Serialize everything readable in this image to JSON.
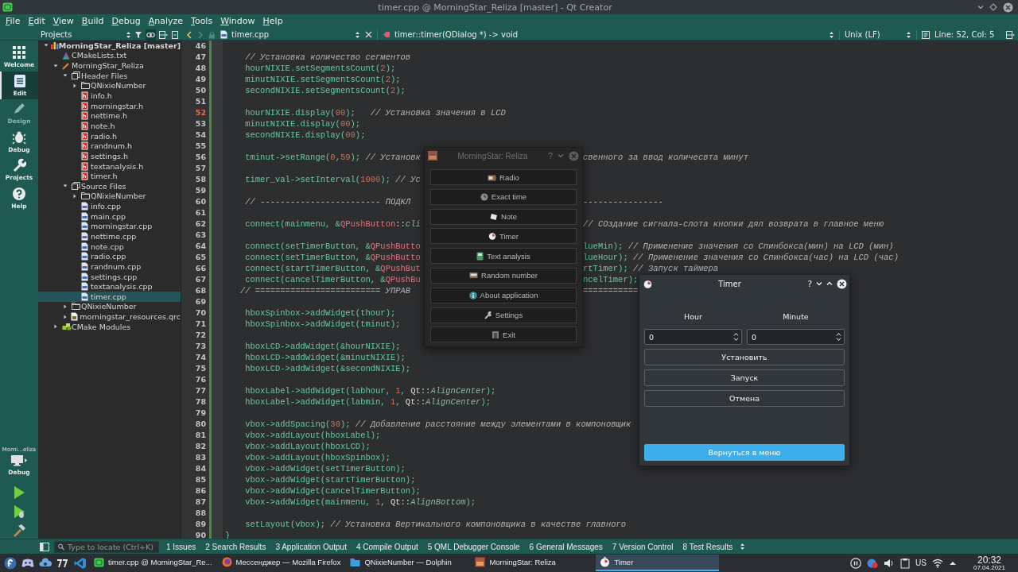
{
  "window": {
    "title": "timer.cpp @ MorningStar_Reliza [master] - Qt Creator"
  },
  "menu": [
    "File",
    "Edit",
    "View",
    "Build",
    "Debug",
    "Analyze",
    "Tools",
    "Window",
    "Help"
  ],
  "modes": [
    {
      "label": "Welcome",
      "selected": false,
      "disabled": false
    },
    {
      "label": "Edit",
      "selected": true,
      "disabled": false
    },
    {
      "label": "Design",
      "selected": false,
      "disabled": true
    },
    {
      "label": "Debug",
      "selected": false,
      "disabled": false
    },
    {
      "label": "Projects",
      "selected": false,
      "disabled": false
    },
    {
      "label": "Help",
      "selected": false,
      "disabled": false
    }
  ],
  "run_target": {
    "name": "Morni...eliza",
    "build": "Debug"
  },
  "projects_pane": {
    "view": "Projects",
    "sync_with_editor": true,
    "tree": [
      {
        "label": "MorningStar_Reliza [master]",
        "kind": "project",
        "expanded": true,
        "selected": false,
        "children": [
          {
            "label": "CMakeLists.txt",
            "kind": "cmake",
            "selected": false
          },
          {
            "label": "MorningStar_Reliza",
            "kind": "target",
            "expanded": true,
            "selected": false,
            "children": [
              {
                "label": "Header Files",
                "kind": "group",
                "expanded": true,
                "selected": false,
                "children": [
                  {
                    "label": "QNixieNumber",
                    "kind": "folder",
                    "expanded": false,
                    "selected": false
                  },
                  {
                    "label": "info.h",
                    "kind": "header",
                    "selected": false
                  },
                  {
                    "label": "morningstar.h",
                    "kind": "header",
                    "selected": false
                  },
                  {
                    "label": "nettime.h",
                    "kind": "header",
                    "selected": false
                  },
                  {
                    "label": "note.h",
                    "kind": "header",
                    "selected": false
                  },
                  {
                    "label": "radio.h",
                    "kind": "header",
                    "selected": false
                  },
                  {
                    "label": "randnum.h",
                    "kind": "header",
                    "selected": false
                  },
                  {
                    "label": "settings.h",
                    "kind": "header",
                    "selected": false
                  },
                  {
                    "label": "textanalysis.h",
                    "kind": "header",
                    "selected": false
                  },
                  {
                    "label": "timer.h",
                    "kind": "header",
                    "selected": false
                  }
                ]
              },
              {
                "label": "Source Files",
                "kind": "group",
                "expanded": true,
                "selected": false,
                "children": [
                  {
                    "label": "QNixieNumber",
                    "kind": "folder",
                    "expanded": false,
                    "selected": false
                  },
                  {
                    "label": "info.cpp",
                    "kind": "source",
                    "selected": false
                  },
                  {
                    "label": "main.cpp",
                    "kind": "source",
                    "selected": false
                  },
                  {
                    "label": "morningstar.cpp",
                    "kind": "source",
                    "selected": false
                  },
                  {
                    "label": "nettime.cpp",
                    "kind": "source",
                    "selected": false
                  },
                  {
                    "label": "note.cpp",
                    "kind": "source",
                    "selected": false
                  },
                  {
                    "label": "radio.cpp",
                    "kind": "source",
                    "selected": false
                  },
                  {
                    "label": "randnum.cpp",
                    "kind": "source",
                    "selected": false
                  },
                  {
                    "label": "settings.cpp",
                    "kind": "source",
                    "selected": false
                  },
                  {
                    "label": "textanalysis.cpp",
                    "kind": "source",
                    "selected": false
                  },
                  {
                    "label": "timer.cpp",
                    "kind": "source",
                    "selected": true
                  }
                ]
              },
              {
                "label": "QNixieNumber",
                "kind": "folder",
                "expanded": false,
                "selected": false
              },
              {
                "label": "morningstar_resources.qrc",
                "kind": "resource",
                "expanded": false,
                "selected": false
              }
            ]
          },
          {
            "label": "CMake Modules",
            "kind": "modules",
            "expanded": false,
            "selected": false
          }
        ]
      }
    ]
  },
  "editor": {
    "file": "timer.cpp",
    "symbol": "timer::timer(QDialog *) -> void",
    "line_ending": "Unix (LF)",
    "position": "Line: 52, Col: 5",
    "lines": [
      {
        "number": "46",
        "current": false
      },
      {
        "number": "47",
        "current": false,
        "text": "    // Установка количество сегментов"
      },
      {
        "number": "48",
        "current": false,
        "text": "    hourNIXIE.setSegmentsCount(2);"
      },
      {
        "number": "49",
        "current": false,
        "text": "    minutNIXIE.setSegmentsCount(2);"
      },
      {
        "number": "50",
        "current": false,
        "text": "    secondNIXIE.setSegmentsCount(2);"
      },
      {
        "number": "51",
        "current": false
      },
      {
        "number": "52",
        "current": true,
        "text": "    hourNIXIE.display(00);   // Установка значения в LCD"
      },
      {
        "number": "53",
        "current": false,
        "text": "    minutNIXIE.display(00);"
      },
      {
        "number": "54",
        "current": false,
        "text": "    secondNIXIE.display(00);"
      },
      {
        "number": "55",
        "current": false
      },
      {
        "number": "56",
        "current": false,
        "text": "    tminut->setRange(0,59); // Установк",
        "right_text": "свенного за ввод количесвта минут"
      },
      {
        "number": "57",
        "current": false
      },
      {
        "number": "58",
        "current": false,
        "text": "    timer_val->setInterval(1000); // Ус"
      },
      {
        "number": "59",
        "current": false
      },
      {
        "number": "60",
        "current": false,
        "text": "    // ------------------------ ПОДКЛ",
        "right_text": "----------------"
      },
      {
        "number": "61",
        "current": false
      },
      {
        "number": "62",
        "current": false,
        "text": "    connect(mainmenu, &QPushButton::cli",
        "right_text": "// СОздание сигнала-слота кнопки дял возврата в главное меню"
      },
      {
        "number": "63",
        "current": false
      },
      {
        "number": "64",
        "current": false,
        "text": "    connect(setTimerButton, &QPushButto",
        "right_text": "lueMin); // Применение значения со Спинбокса(мин) на LCD (мин)"
      },
      {
        "number": "65",
        "current": false,
        "text": "    connect(setTimerButton, &QPushButto",
        "right_text": "lueHour); // Применение значения со Спинбокса(час) на LCD (час)"
      },
      {
        "number": "66",
        "current": false,
        "text": "    connect(startTimerButton, &QPushBut",
        "right_text": "rtTimer); // Запуск таймера"
      },
      {
        "number": "67",
        "current": false,
        "text": "    connect(cancelTimerButton, &QPushBu",
        "right_text": "ncelTimer);"
      },
      {
        "number": "68",
        "current": false,
        "text": "   // ========================= УПРАВ",
        "right_text": "==========="
      },
      {
        "number": "69",
        "current": false
      },
      {
        "number": "70",
        "current": false,
        "text": "    hboxSpinbox->addWidget(thour);"
      },
      {
        "number": "71",
        "current": false,
        "text": "    hboxSpinbox->addWidget(tminut);"
      },
      {
        "number": "72",
        "current": false
      },
      {
        "number": "73",
        "current": false,
        "text": "    hboxLCD->addWidget(&hourNIXIE);"
      },
      {
        "number": "74",
        "current": false,
        "text": "    hboxLCD->addWidget(&minutNIXIE);"
      },
      {
        "number": "75",
        "current": false,
        "text": "    hboxLCD->addWidget(&secondNIXIE);"
      },
      {
        "number": "76",
        "current": false
      },
      {
        "number": "77",
        "current": false,
        "text": "    hboxLabel->addWidget(labhour, 1, Qt::AlignCenter);"
      },
      {
        "number": "78",
        "current": false,
        "text": "    hboxLabel->addWidget(labmin, 1, Qt::AlignCenter);"
      },
      {
        "number": "79",
        "current": false
      },
      {
        "number": "80",
        "current": false,
        "text": "    vbox->addSpacing(30); // Добавление расстояние между элементами в компоновщик"
      },
      {
        "number": "81",
        "current": false,
        "text": "    vbox->addLayout(hboxLabel);"
      },
      {
        "number": "82",
        "current": false,
        "text": "    vbox->addLayout(hboxLCD);"
      },
      {
        "number": "83",
        "current": false,
        "text": "    vbox->addLayout(hboxSpinbox);"
      },
      {
        "number": "84",
        "current": false,
        "text": "    vbox->addWidget(setTimerButton);"
      },
      {
        "number": "85",
        "current": false,
        "text": "    vbox->addWidget(startTimerButton);"
      },
      {
        "number": "86",
        "current": false,
        "text": "    vbox->addWidget(cancelTimerButton);"
      },
      {
        "number": "87",
        "current": false,
        "text": "    vbox->addWidget(mainmenu, 1, Qt::AlignBottom);"
      },
      {
        "number": "88",
        "current": false
      },
      {
        "number": "89",
        "current": false,
        "text": "    setLayout(vbox); // Установка Вертикального компоновщика в качестве главного"
      },
      {
        "number": "90",
        "current": false,
        "text": "}"
      }
    ]
  },
  "output_pane": {
    "locator": {
      "placeholder": "Type to locate (Ctrl+K)"
    },
    "tabs": [
      "1 Issues",
      "2 Search Results",
      "3 Application Output",
      "4 Compile Output",
      "5 QML Debugger Console",
      "6 General Messages",
      "7 Version Control",
      "8 Test Results"
    ]
  },
  "menu_dialog": {
    "title": "MorningStar: Reliza",
    "help": "?",
    "buttons": [
      "Radio",
      "Exact time",
      "Note",
      "Timer",
      "Text analysis",
      "Random number",
      "About application",
      "Settings",
      "Exit"
    ]
  },
  "timer_dialog": {
    "title": "Timer",
    "help": "?",
    "fields": [
      {
        "label": "Hour",
        "value": "0"
      },
      {
        "label": "Minute",
        "value": "0"
      }
    ],
    "buttons": [
      {
        "label": "Установить",
        "default": false
      },
      {
        "label": "Запуск",
        "default": false
      },
      {
        "label": "Отмена",
        "default": false
      },
      {
        "label": "Вернуться в меню",
        "default": true
      }
    ]
  },
  "taskbar": {
    "tasks": [
      {
        "label": "timer.cpp @ MorningStar_Re...",
        "selected": false
      },
      {
        "label": "Мессенджер — Mozilla Firefox",
        "selected": false
      },
      {
        "label": "QNixieNumber — Dolphin",
        "selected": false
      },
      {
        "label": "MorningStar: Reliza",
        "selected": false
      },
      {
        "label": "Timer",
        "selected": true
      }
    ],
    "keyboard_layout": "US",
    "time": "20:32",
    "date": "07.04.2021"
  }
}
